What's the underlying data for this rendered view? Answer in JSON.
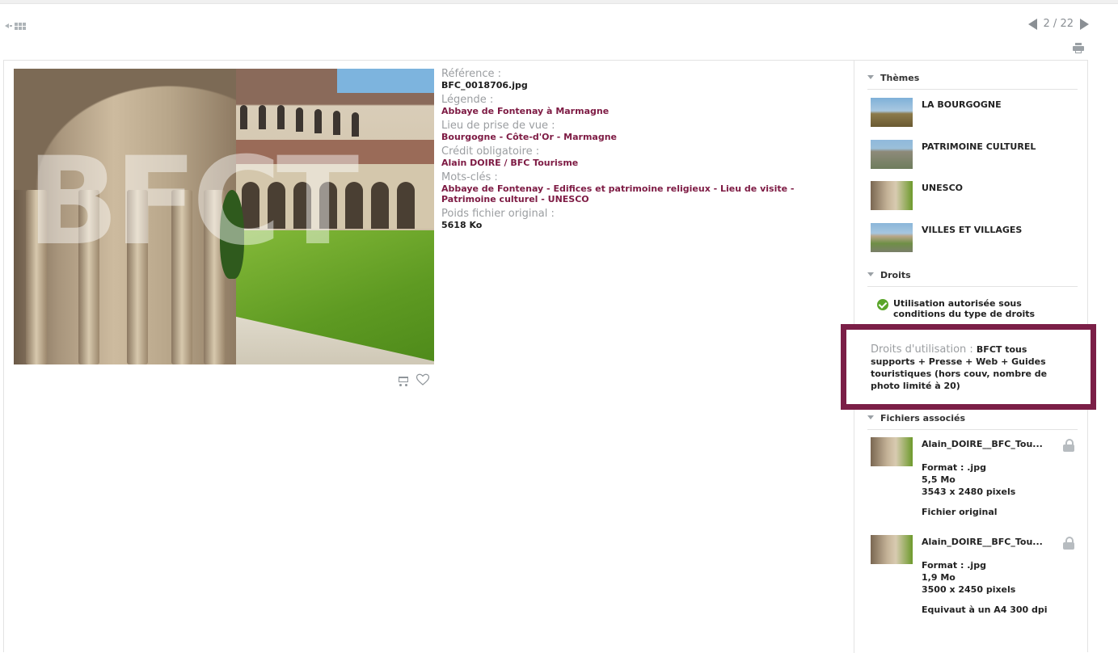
{
  "pager": {
    "current": "2 / 22"
  },
  "watermark": "BFCT",
  "meta": {
    "reference_label": "Référence :",
    "reference_value": "BFC_0018706.jpg",
    "legende_label": "Légende :",
    "legende_value": "Abbaye de Fontenay à Marmagne",
    "lieu_label": "Lieu de prise de vue :",
    "lieu_value": "Bourgogne - Côte-d'Or - Marmagne",
    "credit_label": "Crédit obligatoire :",
    "credit_value": "Alain DOIRE / BFC Tourisme",
    "mots_label": "Mots-clés :",
    "mots_value": "Abbaye de Fontenay - Edifices et patrimoine religieux - Lieu de visite - Patrimoine culturel - UNESCO",
    "poids_label": "Poids fichier original :",
    "poids_value": "5618 Ko"
  },
  "sidebar": {
    "themes_title": "Thèmes",
    "themes": [
      {
        "name": "LA BOURGOGNE"
      },
      {
        "name": "PATRIMOINE CULTUREL"
      },
      {
        "name": "UNESCO"
      },
      {
        "name": "VILLES ET VILLAGES"
      }
    ],
    "droits_title": "Droits",
    "droits_status": "Utilisation autorisée sous conditions du type de droits",
    "usage_label": "Droits d'utilisation : ",
    "usage_value": "BFCT tous supports + Presse + Web + Guides touristiques (hors couv, nombre de photo limité à 20)",
    "files_title": "Fichiers associés",
    "files": [
      {
        "name": "Alain_DOIRE__BFC_Tou...",
        "format": "Format : .jpg",
        "size": "5,5 Mo",
        "dims": "3543 x 2480 pixels",
        "note": "Fichier original"
      },
      {
        "name": "Alain_DOIRE__BFC_Tou...",
        "format": "Format : .jpg",
        "size": "1,9 Mo",
        "dims": "3500 x 2450 pixels",
        "note": "Equivaut à un A4 300 dpi"
      }
    ]
  },
  "colors": {
    "accent_wine": "#7d1a43",
    "highlight_border": "#7b1f47",
    "ok_green": "#5aa52a"
  },
  "icons": [
    "back-to-grid-icon",
    "prev-arrow-icon",
    "next-arrow-icon",
    "print-icon",
    "cart-icon",
    "heart-icon",
    "caret-down-icon",
    "check-circle-icon",
    "lock-icon"
  ]
}
